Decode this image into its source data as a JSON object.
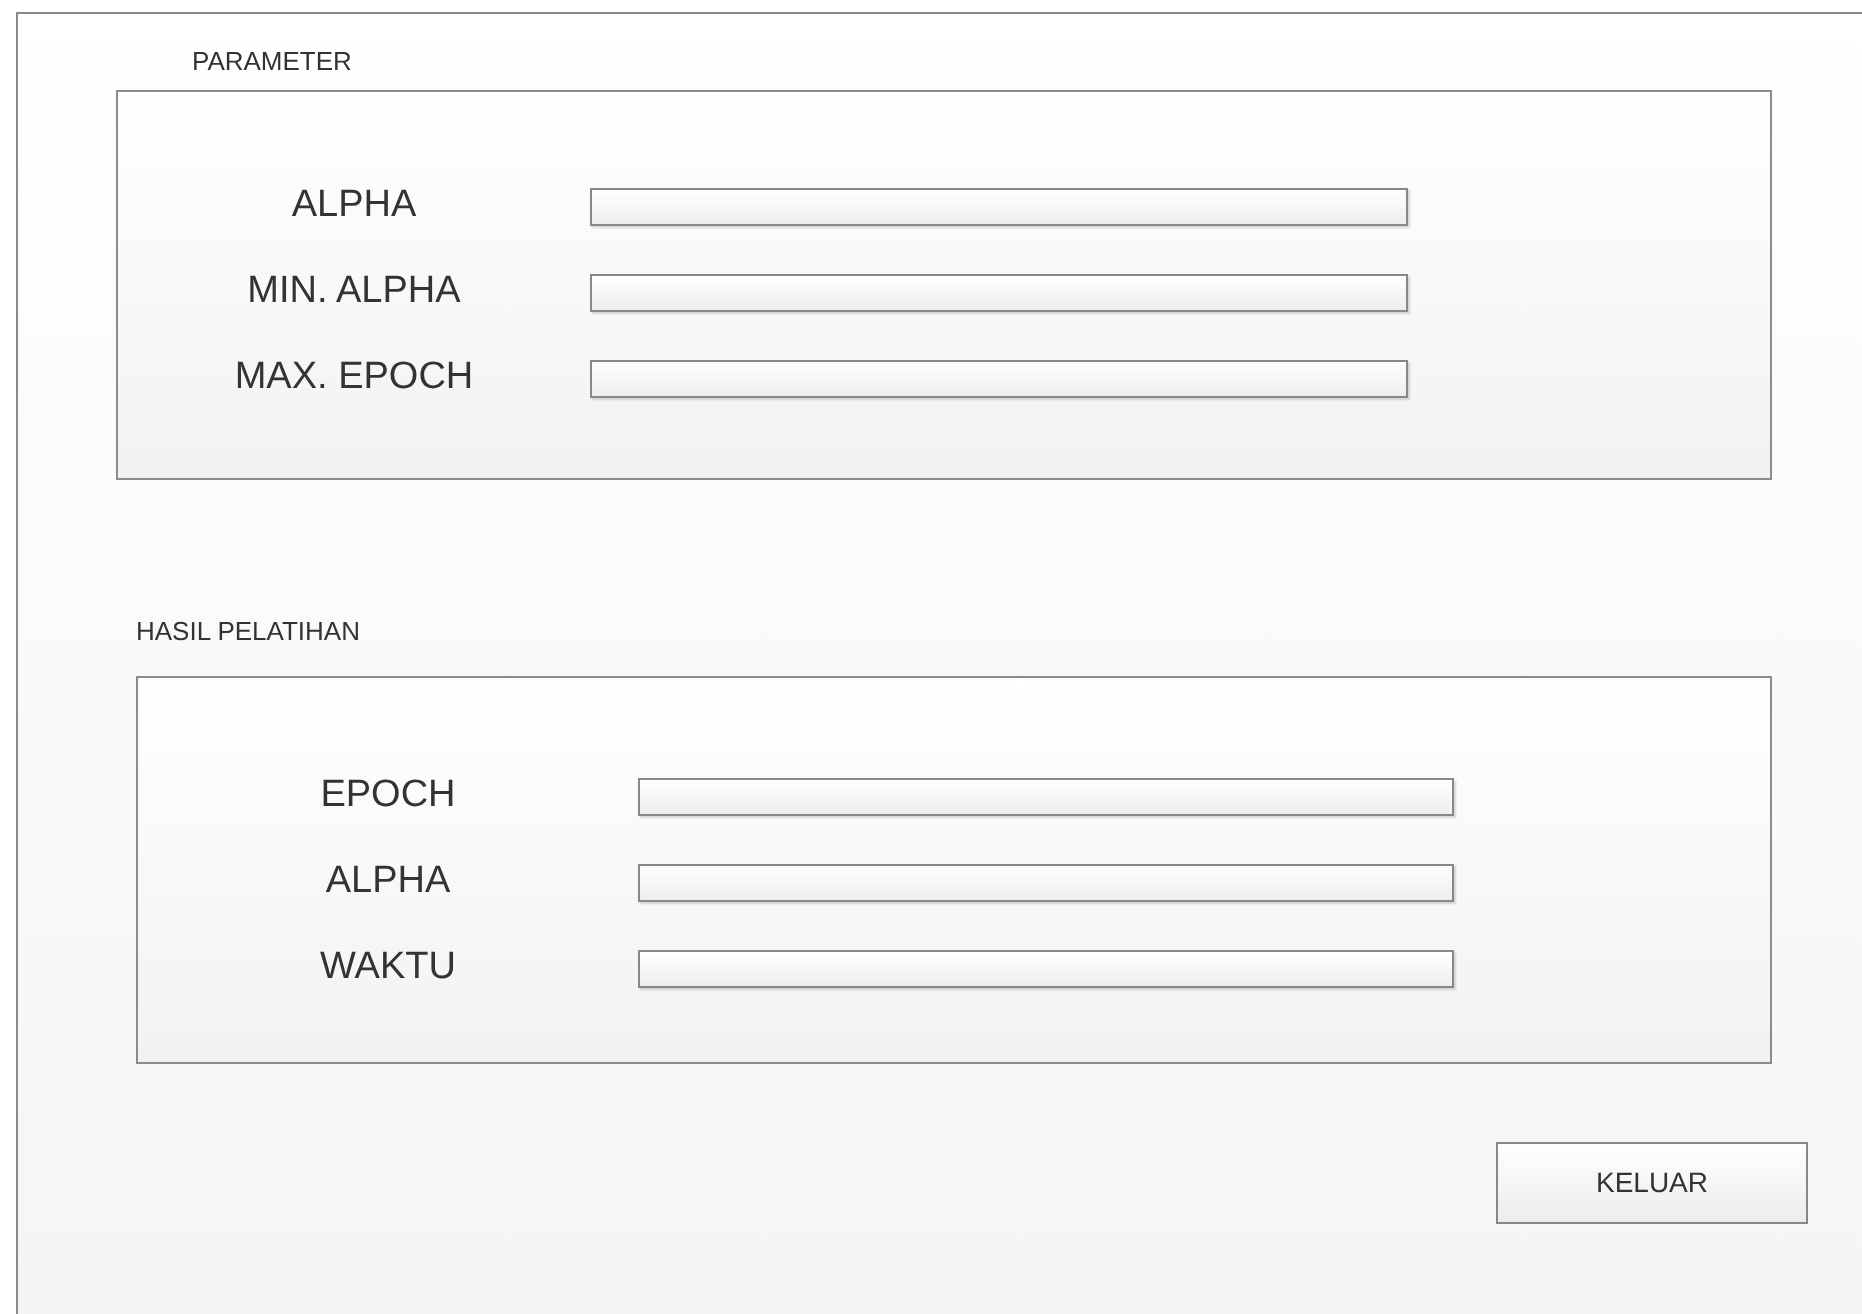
{
  "sections": [
    {
      "title": "PARAMETER",
      "fields": [
        {
          "label": "ALPHA"
        },
        {
          "label": "MIN. ALPHA"
        },
        {
          "label": "MAX. EPOCH"
        }
      ]
    },
    {
      "title": "HASIL PELATIHAN",
      "fields": [
        {
          "label": "EPOCH"
        },
        {
          "label": "ALPHA"
        },
        {
          "label": "WAKTU"
        }
      ]
    }
  ],
  "button": "KELUAR"
}
